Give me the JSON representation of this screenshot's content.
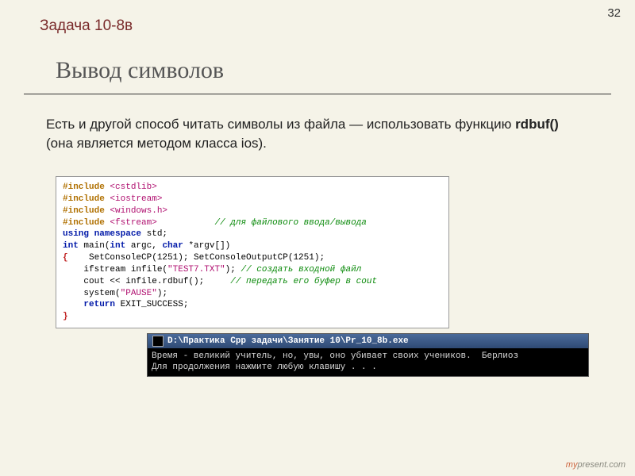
{
  "page_number": "32",
  "task_label": "Задача 10-8в",
  "title": "Вывод символов",
  "paragraph_prefix": "Есть и другой способ читать символы из файла — использовать функцию ",
  "paragraph_bold": "rdbuf()",
  "paragraph_suffix": " (она является методом класса ios).",
  "code": {
    "include1": "#include ",
    "include1h": "<cstdlib>",
    "include2": "#include ",
    "include2h": "<iostream>",
    "include3": "#include ",
    "include3h": "<windows.h>",
    "include4": "#include ",
    "include4h": "<fstream>",
    "cmt1": "// для файлового ввода/вывода",
    "using": "using namespace",
    "using_tail": " std;",
    "intmain1": "int",
    "intmain2": " main(",
    "intmain3": "int",
    "intmain4": " argc, ",
    "intmain5": "char",
    "intmain6": " *argv[])",
    "l1": "    SetConsoleCP(1251); SetConsoleOutputCP(1251);",
    "l2a": "    ifstream infile(",
    "l2b": "\"TEST7.TXT\"",
    "l2c": "); ",
    "cmt2": "// создать входной файл",
    "l3": "    cout << infile.rdbuf();     ",
    "cmt3": "// передать его буфер в cout",
    "l4a": "    system(",
    "l4b": "\"PAUSE\"",
    "l4c": ");",
    "ret1": "    return",
    "ret2": " EXIT_SUCCESS;",
    "ob": "{",
    "cb": "}"
  },
  "console": {
    "path": "D:\\Практика Cpp задачи\\Занятие 10\\Pr_10_8b.exe",
    "line1": "Время - великий учитель, но, увы, оно убивает своих учеников.  Берлиоз",
    "line2": "Для продолжения нажмите любую клавишу . . ."
  },
  "watermark_plain": "present.com",
  "watermark_red": "my"
}
